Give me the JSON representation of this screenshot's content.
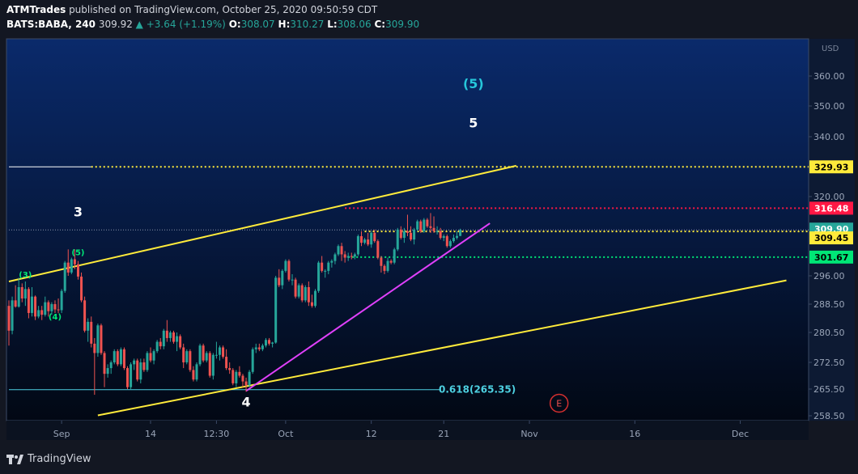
{
  "header": {
    "author": "ATMTrades",
    "published_text": " published on TradingView.com, October 25, 2020 09:50:59 CDT",
    "symbol": "BATS:BABA, 240",
    "last": "309.92",
    "change": "+3.64 (+1.19%)",
    "o_label": "O:",
    "o_value": "308.07",
    "h_label": "H:",
    "h_value": "310.27",
    "l_label": "L:",
    "l_value": "308.06",
    "c_label": "C:",
    "c_value": "309.90"
  },
  "footer": {
    "brand": "TradingView"
  },
  "colors": {
    "background_top": "#0a2a6b",
    "background_bottom": "#020814",
    "up": "#26a69a",
    "down": "#ef5350",
    "channel": "#ffeb3b",
    "trendline": "#e040fb",
    "fib_line": "#4dd0e1",
    "level_white": "#ffffff",
    "level_red": "#ff1744",
    "level_green": "#00e676"
  },
  "chart_data": {
    "type": "candlestick",
    "currency_label": "USD",
    "y_ticks": [
      258.5,
      265.5,
      272.5,
      280.5,
      288.5,
      296.0,
      320.0,
      340.0,
      350.0,
      360.0
    ],
    "y_tick_labels": [
      "258.50",
      "265.50",
      "272.50",
      "280.50",
      "288.50",
      "296.00",
      "320.00",
      "340.00",
      "350.00",
      "360.00"
    ],
    "x_ticks": [
      {
        "label": "Sep",
        "bar": 16
      },
      {
        "label": "14",
        "bar": 43
      },
      {
        "label": "12:30",
        "bar": 63
      },
      {
        "label": "Oct",
        "bar": 84
      },
      {
        "label": "12",
        "bar": 110
      },
      {
        "label": "21",
        "bar": 132
      },
      {
        "label": "Nov",
        "bar": 158
      },
      {
        "label": "16",
        "bar": 190
      },
      {
        "label": "Dec",
        "bar": 222
      }
    ],
    "price_labels": [
      {
        "value": 329.93,
        "text": "329.93",
        "style": "yellow"
      },
      {
        "value": 316.48,
        "text": "316.48",
        "style": "red"
      },
      {
        "value": 309.9,
        "text": "309.90",
        "style": "green"
      },
      {
        "value": 309.45,
        "text": "309.45",
        "style": "yellow"
      },
      {
        "value": 301.67,
        "text": "301.67",
        "style": "greenbright"
      }
    ],
    "horizontal_levels": [
      {
        "value": 329.93,
        "style": "white-solid",
        "from_bar": 0,
        "to_bar": 25
      },
      {
        "value": 329.93,
        "style": "yellow-dotted",
        "from_bar": 25,
        "to_bar": 245
      },
      {
        "value": 316.48,
        "style": "red-dotted",
        "from_bar": 102,
        "to_bar": 245
      },
      {
        "value": 309.9,
        "style": "grey-dotted",
        "from_bar": 0,
        "to_bar": 245
      },
      {
        "value": 309.45,
        "style": "yellow-dotted",
        "from_bar": 108,
        "to_bar": 245
      },
      {
        "value": 301.67,
        "style": "green-dotted",
        "from_bar": 103,
        "to_bar": 245
      },
      {
        "value": 265.35,
        "style": "fib-solid",
        "from_bar": 0,
        "to_bar": 131
      }
    ],
    "fib_label": "0.618(265.35)",
    "trendlines": [
      {
        "style": "channel",
        "from": {
          "bar": 0,
          "value": 294.5
        },
        "to": {
          "bar": 154,
          "value": 330.3
        }
      },
      {
        "style": "channel",
        "from": {
          "bar": 27,
          "value": 258.6
        },
        "to": {
          "bar": 236,
          "value": 294.8
        }
      },
      {
        "style": "magenta",
        "from": {
          "bar": 72,
          "value": 265.0
        },
        "to": {
          "bar": 146,
          "value": 311.9
        }
      }
    ],
    "wave_labels": [
      {
        "text": "(5)",
        "bar": 141,
        "value": 356.0,
        "style": "cyan"
      },
      {
        "text": "5",
        "bar": 141,
        "value": 343.0,
        "style": "white"
      },
      {
        "text": "3",
        "bar": 21,
        "value": 314.0,
        "style": "white"
      },
      {
        "text": "(5)",
        "bar": 21,
        "value": 302.2,
        "style": "green"
      },
      {
        "text": "(3)",
        "bar": 5,
        "value": 295.6,
        "style": "green"
      },
      {
        "text": "(4)",
        "bar": 14,
        "value": 284.2,
        "style": "green"
      },
      {
        "text": "4",
        "bar": 72,
        "value": 260.9,
        "style": "white"
      }
    ],
    "event_marker": {
      "text": "E",
      "bar": 167,
      "value": 261.8
    },
    "candles": [
      [
        288.0,
        289.5,
        277.0,
        281.0
      ],
      [
        281.0,
        290.5,
        280.0,
        289.5
      ],
      [
        289.5,
        293.5,
        287.5,
        287.8
      ],
      [
        287.8,
        295.5,
        287.5,
        293.0
      ],
      [
        293.0,
        294.0,
        289.0,
        290.0
      ],
      [
        290.0,
        294.5,
        288.0,
        292.5
      ],
      [
        292.5,
        293.0,
        284.5,
        286.0
      ],
      [
        286.0,
        293.0,
        285.0,
        290.5
      ],
      [
        290.5,
        290.8,
        284.0,
        285.0
      ],
      [
        285.0,
        288.0,
        284.5,
        286.8
      ],
      [
        286.8,
        288.0,
        284.0,
        285.5
      ],
      [
        285.5,
        290.5,
        285.0,
        289.0
      ],
      [
        289.0,
        289.5,
        285.0,
        286.5
      ],
      [
        286.5,
        289.0,
        285.5,
        288.5
      ],
      [
        288.5,
        289.5,
        286.0,
        287.0
      ],
      [
        287.0,
        290.0,
        286.0,
        286.8
      ],
      [
        286.8,
        292.5,
        286.0,
        292.0
      ],
      [
        292.0,
        300.5,
        291.5,
        300.0
      ],
      [
        300.0,
        304.0,
        296.0,
        297.0
      ],
      [
        297.0,
        301.5,
        296.5,
        301.0
      ],
      [
        301.0,
        304.0,
        298.0,
        299.5
      ],
      [
        299.5,
        300.5,
        295.0,
        295.8
      ],
      [
        295.8,
        297.0,
        289.0,
        289.5
      ],
      [
        289.5,
        290.5,
        280.5,
        281.0
      ],
      [
        281.0,
        284.5,
        278.0,
        283.5
      ],
      [
        283.5,
        285.0,
        276.5,
        277.5
      ],
      [
        277.5,
        279.0,
        264.0,
        275.0
      ],
      [
        275.0,
        283.0,
        274.0,
        282.5
      ],
      [
        282.5,
        283.0,
        274.5,
        275.0
      ],
      [
        275.0,
        275.5,
        266.0,
        269.5
      ],
      [
        269.5,
        272.0,
        268.5,
        271.0
      ],
      [
        271.0,
        273.0,
        269.5,
        272.5
      ],
      [
        272.5,
        276.0,
        272.0,
        275.5
      ],
      [
        275.5,
        276.0,
        271.5,
        272.0
      ],
      [
        272.0,
        276.5,
        271.5,
        276.0
      ],
      [
        276.0,
        276.5,
        270.5,
        271.0
      ],
      [
        271.0,
        271.5,
        265.5,
        266.0
      ],
      [
        266.0,
        272.5,
        265.5,
        272.0
      ],
      [
        272.0,
        273.5,
        270.5,
        273.0
      ],
      [
        273.0,
        273.5,
        267.5,
        268.0
      ],
      [
        268.0,
        273.5,
        267.0,
        272.5
      ],
      [
        272.5,
        273.5,
        270.0,
        270.5
      ],
      [
        270.5,
        275.5,
        270.0,
        275.0
      ],
      [
        275.0,
        276.5,
        272.5,
        273.0
      ],
      [
        273.0,
        276.0,
        272.0,
        275.5
      ],
      [
        275.5,
        278.5,
        275.0,
        278.0
      ],
      [
        278.0,
        279.0,
        276.0,
        276.8
      ],
      [
        276.8,
        281.5,
        276.0,
        281.0
      ],
      [
        281.0,
        284.0,
        278.0,
        279.0
      ],
      [
        279.0,
        281.0,
        278.0,
        280.5
      ],
      [
        280.5,
        281.0,
        277.5,
        278.0
      ],
      [
        278.0,
        280.5,
        275.5,
        279.5
      ],
      [
        279.5,
        280.0,
        276.0,
        276.5
      ],
      [
        276.5,
        277.5,
        271.0,
        272.5
      ],
      [
        272.5,
        276.0,
        272.0,
        275.5
      ],
      [
        275.5,
        276.0,
        270.0,
        270.5
      ],
      [
        270.5,
        271.5,
        267.5,
        268.0
      ],
      [
        268.0,
        272.5,
        267.5,
        272.0
      ],
      [
        272.0,
        277.5,
        271.5,
        277.0
      ],
      [
        277.0,
        277.5,
        272.5,
        273.0
      ],
      [
        273.0,
        275.5,
        272.5,
        275.0
      ],
      [
        275.0,
        275.5,
        268.5,
        269.0
      ],
      [
        269.0,
        275.0,
        268.0,
        274.5
      ],
      [
        274.5,
        278.0,
        273.5,
        274.5
      ],
      [
        274.5,
        277.0,
        273.0,
        276.5
      ],
      [
        276.5,
        277.0,
        273.5,
        274.0
      ],
      [
        274.0,
        276.0,
        270.5,
        271.0
      ],
      [
        271.0,
        272.5,
        269.5,
        270.5
      ],
      [
        270.5,
        271.0,
        266.5,
        267.0
      ],
      [
        267.0,
        270.5,
        266.0,
        270.0
      ],
      [
        270.0,
        271.5,
        268.5,
        269.0
      ],
      [
        269.0,
        269.5,
        266.0,
        267.5
      ],
      [
        267.5,
        268.5,
        264.8,
        266.5
      ],
      [
        266.5,
        270.5,
        266.0,
        270.0
      ],
      [
        270.0,
        276.5,
        269.5,
        276.0
      ],
      [
        276.0,
        277.5,
        275.0,
        276.5
      ],
      [
        276.5,
        277.5,
        275.5,
        276.0
      ],
      [
        276.0,
        277.5,
        275.5,
        277.0
      ],
      [
        277.0,
        279.0,
        276.5,
        278.5
      ],
      [
        278.5,
        279.0,
        277.0,
        277.5
      ],
      [
        277.5,
        278.0,
        276.5,
        277.8
      ],
      [
        277.8,
        296.0,
        277.5,
        295.5
      ],
      [
        295.5,
        298.0,
        293.0,
        293.5
      ],
      [
        293.5,
        298.0,
        292.5,
        297.5
      ],
      [
        297.5,
        301.0,
        297.0,
        300.5
      ],
      [
        300.5,
        301.0,
        294.5,
        295.0
      ],
      [
        295.0,
        296.5,
        293.5,
        295.0
      ],
      [
        295.0,
        295.5,
        290.0,
        290.5
      ],
      [
        290.5,
        294.0,
        290.0,
        293.5
      ],
      [
        293.5,
        294.0,
        289.0,
        289.5
      ],
      [
        289.5,
        293.5,
        289.0,
        293.0
      ],
      [
        293.0,
        294.5,
        288.0,
        289.0
      ],
      [
        289.0,
        291.0,
        287.5,
        288.0
      ],
      [
        288.0,
        292.5,
        287.5,
        292.0
      ],
      [
        292.0,
        300.5,
        291.5,
        300.0
      ],
      [
        300.0,
        302.0,
        297.0,
        297.5
      ],
      [
        297.5,
        298.0,
        295.5,
        297.5
      ],
      [
        297.5,
        300.5,
        296.5,
        300.0
      ],
      [
        300.0,
        301.0,
        298.5,
        300.5
      ],
      [
        300.5,
        303.0,
        299.5,
        302.5
      ],
      [
        302.5,
        305.5,
        302.0,
        305.0
      ],
      [
        305.0,
        306.0,
        300.5,
        302.5
      ],
      [
        302.5,
        303.5,
        300.0,
        301.5
      ],
      [
        301.5,
        303.0,
        300.5,
        302.0
      ],
      [
        302.0,
        303.0,
        301.0,
        301.8
      ],
      [
        301.8,
        303.0,
        301.0,
        302.5
      ],
      [
        302.5,
        308.5,
        302.0,
        308.0
      ],
      [
        308.0,
        309.5,
        305.0,
        306.0
      ],
      [
        306.0,
        307.5,
        305.5,
        307.0
      ],
      [
        307.0,
        309.0,
        305.0,
        305.5
      ],
      [
        305.5,
        309.5,
        304.5,
        309.0
      ],
      [
        309.0,
        310.0,
        306.0,
        306.5
      ],
      [
        306.5,
        307.0,
        301.0,
        301.5
      ],
      [
        301.5,
        302.0,
        297.0,
        299.0
      ],
      [
        299.0,
        299.5,
        296.5,
        297.5
      ],
      [
        297.5,
        301.5,
        297.0,
        300.5
      ],
      [
        300.5,
        301.0,
        299.5,
        300.0
      ],
      [
        300.0,
        304.5,
        299.5,
        304.0
      ],
      [
        304.0,
        310.5,
        303.5,
        310.0
      ],
      [
        310.0,
        311.0,
        307.0,
        307.5
      ],
      [
        307.5,
        310.5,
        306.0,
        309.5
      ],
      [
        309.5,
        314.5,
        308.0,
        309.0
      ],
      [
        309.0,
        311.0,
        306.5,
        307.0
      ],
      [
        307.0,
        310.5,
        305.5,
        310.0
      ],
      [
        310.0,
        313.0,
        309.5,
        312.5
      ],
      [
        312.5,
        313.0,
        309.0,
        309.5
      ],
      [
        309.5,
        313.5,
        309.0,
        313.0
      ],
      [
        313.0,
        313.5,
        310.5,
        311.0
      ],
      [
        311.0,
        315.0,
        309.0,
        310.5
      ],
      [
        310.5,
        314.0,
        309.0,
        309.5
      ],
      [
        309.5,
        311.0,
        308.5,
        309.5
      ],
      [
        309.5,
        310.5,
        307.0,
        307.5
      ],
      [
        307.5,
        308.5,
        306.5,
        308.0
      ],
      [
        308.0,
        308.5,
        304.5,
        305.0
      ],
      [
        305.0,
        307.0,
        304.5,
        306.5
      ],
      [
        306.5,
        308.5,
        306.0,
        307.5
      ],
      [
        307.5,
        309.5,
        307.0,
        308.07
      ],
      [
        308.07,
        310.27,
        308.06,
        309.9
      ]
    ]
  }
}
